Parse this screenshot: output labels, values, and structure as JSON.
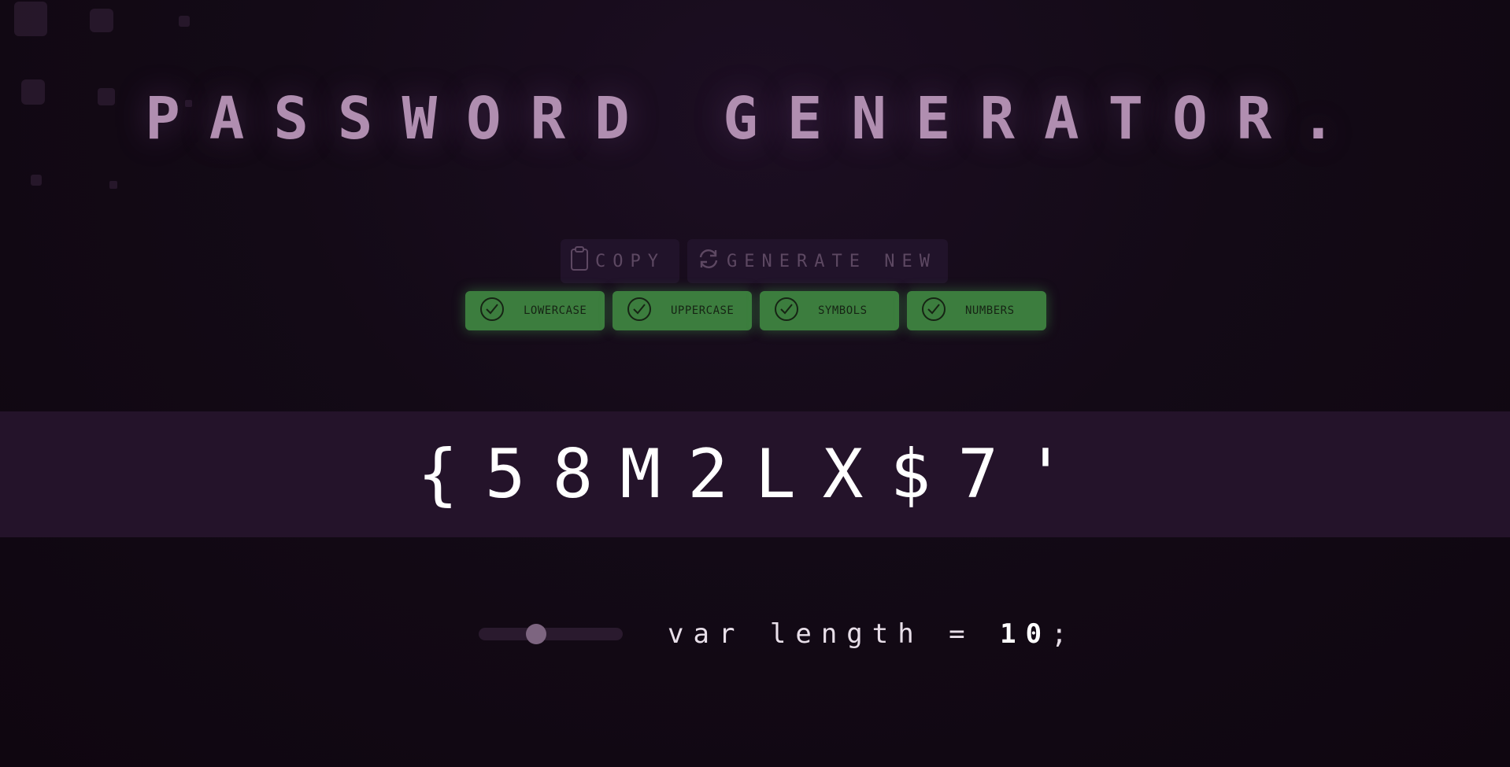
{
  "title": "PASSWORD GENERATOR.",
  "actions": {
    "copy_label": "COPY",
    "copy_icon": "clipboard-icon",
    "generate_label": "GENERATE NEW",
    "generate_icon": "refresh-icon"
  },
  "options": [
    {
      "label": "LOWERCASE",
      "checked": true
    },
    {
      "label": "UPPERCASE",
      "checked": true
    },
    {
      "label": "SYMBOLS",
      "checked": true
    },
    {
      "label": "NUMBERS",
      "checked": true
    }
  ],
  "password": "{58M2LX$7'",
  "length": {
    "prefix": "var length =",
    "value": "10",
    "suffix": ";",
    "slider_fraction": 0.38
  },
  "colors": {
    "background": "#120812",
    "title": "#b08eb0",
    "option_green": "#3c7d3e",
    "band": "#24132a"
  }
}
